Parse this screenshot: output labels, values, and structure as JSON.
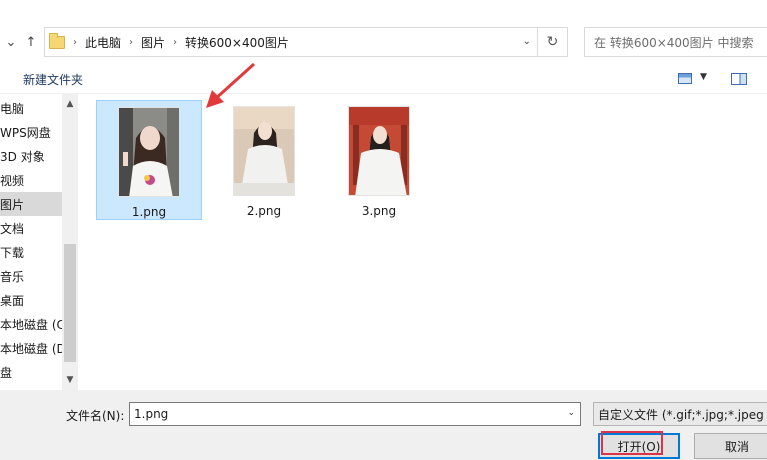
{
  "nav": {
    "back_icon": "back-arrow-icon",
    "up_icon": "up-arrow-icon",
    "breadcrumbs": [
      "此电脑",
      "图片",
      "转换600×400图片"
    ],
    "search_placeholder": "在 转换600×400图片 中搜索"
  },
  "toolbar": {
    "new_folder": "新建文件夹"
  },
  "sidebar": {
    "items": [
      "电脑",
      "WPS网盘",
      "3D 对象",
      "视频",
      "图片",
      "文档",
      "下载",
      "音乐",
      "桌面",
      "本地磁盘 (C",
      "本地磁盘 (D",
      "盘"
    ],
    "selected_index": 4
  },
  "files": [
    {
      "name": "1.png",
      "selected": true
    },
    {
      "name": "2.png",
      "selected": false
    },
    {
      "name": "3.png",
      "selected": false
    }
  ],
  "bottom": {
    "filename_label": "文件名(N):",
    "filename_value": "1.png",
    "filetype_value": "自定义文件 (*.gif;*.jpg;*.jpeg",
    "open_label": "打开(O)",
    "cancel_label": "取消"
  },
  "colors": {
    "selection_bg": "#cce8ff",
    "selection_border": "#99d1ff",
    "annotation_red": "#e23a3a",
    "primary_border": "#0078d7"
  }
}
